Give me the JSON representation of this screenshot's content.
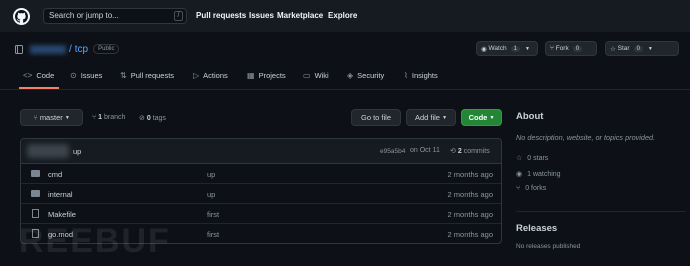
{
  "header": {
    "search_placeholder": "Search or jump to...",
    "search_shortcut": "/",
    "nav": [
      "Pull requests",
      "Issues",
      "Marketplace",
      "Explore"
    ]
  },
  "repo": {
    "slash": "/",
    "name": "tcp",
    "visibility": "Public",
    "watch": {
      "label": "Watch",
      "count": "1"
    },
    "fork": {
      "label": "Fork",
      "count": "0"
    },
    "star": {
      "label": "Star",
      "count": "0"
    }
  },
  "tabs": [
    "Code",
    "Issues",
    "Pull requests",
    "Actions",
    "Projects",
    "Wiki",
    "Security",
    "Insights"
  ],
  "toolbar": {
    "branch": "master",
    "branch_count": "1",
    "branch_label": "branch",
    "tags_count": "0",
    "tags_label": "tags",
    "go_to_file": "Go to file",
    "add_file": "Add file",
    "code": "Code"
  },
  "commit": {
    "message": "up",
    "hash": "e95a5b4",
    "on_date": "on Oct 11",
    "commits_count": "2",
    "commits_label": "commits"
  },
  "files": [
    {
      "name": "cmd",
      "message": "up",
      "age": "2 months ago",
      "type": "folder"
    },
    {
      "name": "internal",
      "message": "up",
      "age": "2 months ago",
      "type": "folder"
    },
    {
      "name": "Makefile",
      "message": "first",
      "age": "2 months ago",
      "type": "file"
    },
    {
      "name": "go.mod",
      "message": "first",
      "age": "2 months ago",
      "type": "file"
    }
  ],
  "about": {
    "title": "About",
    "description": "No description, website, or topics provided.",
    "stars": "0 stars",
    "watching": "1 watching",
    "forks": "0 forks"
  },
  "releases": {
    "title": "Releases",
    "text": "No releases published"
  },
  "watermark": "REEBUF",
  "colors": {
    "accent": "#58a6ff",
    "green": "#238636",
    "underline": "#f78166",
    "bg": "#0d1117"
  }
}
